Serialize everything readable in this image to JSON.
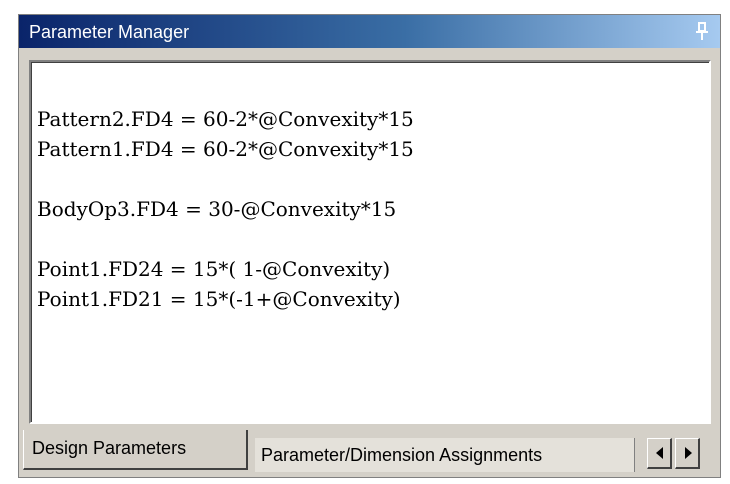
{
  "window": {
    "title": "Parameter Manager",
    "title_gradient": [
      "#0a246a",
      "#a6caf0"
    ],
    "pin_icon": "pushpin-icon"
  },
  "editor": {
    "lines": [
      "",
      "Pattern2.FD4 = 60-2*@Convexity*15",
      "Pattern1.FD4 = 60-2*@Convexity*15",
      "",
      "BodyOp3.FD4 = 30-@Convexity*15",
      "",
      "Point1.FD24 = 15*( 1-@Convexity)",
      "Point1.FD21 = 15*(-1+@Convexity)"
    ]
  },
  "tabs": [
    {
      "label": "Design Parameters",
      "active": true
    },
    {
      "label": "Parameter/Dimension Assignments",
      "active": false
    }
  ],
  "tab_scroll": {
    "left_icon": "arrow-left-icon",
    "right_icon": "arrow-right-icon"
  }
}
